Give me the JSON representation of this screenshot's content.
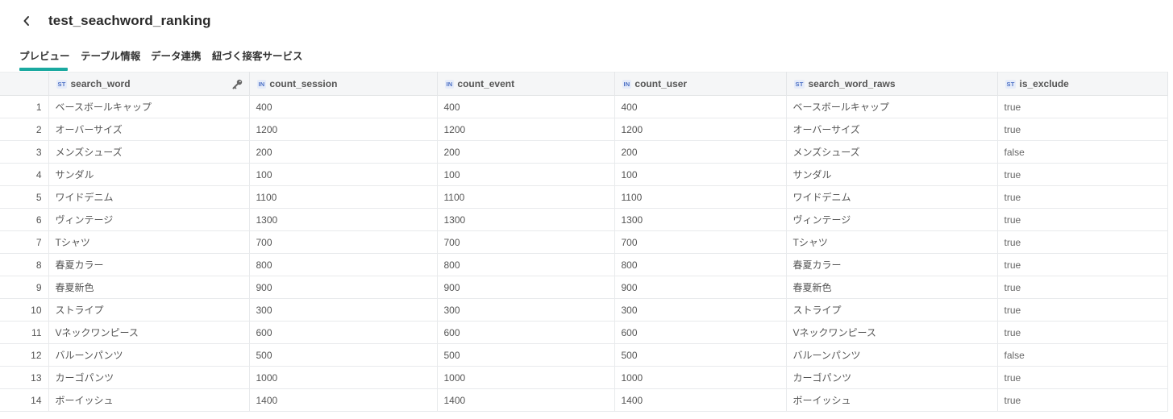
{
  "header": {
    "title": "test_seachword_ranking"
  },
  "tabs": [
    {
      "label": "プレビュー"
    },
    {
      "label": "テーブル情報"
    },
    {
      "label": "データ連携"
    },
    {
      "label": "紐づく接客サービス"
    }
  ],
  "columns": [
    {
      "type": "ST",
      "name": "search_word"
    },
    {
      "type": "IN",
      "name": "count_session"
    },
    {
      "type": "IN",
      "name": "count_event"
    },
    {
      "type": "IN",
      "name": "count_user"
    },
    {
      "type": "ST",
      "name": "search_word_raws"
    },
    {
      "type": "ST",
      "name": "is_exclude"
    }
  ],
  "rows": [
    {
      "num": "1",
      "cells": [
        "ベースボールキャップ",
        "400",
        "400",
        "400",
        "ベースボールキャップ",
        "true"
      ]
    },
    {
      "num": "2",
      "cells": [
        "オーバーサイズ",
        "1200",
        "1200",
        "1200",
        "オーバーサイズ",
        "true"
      ]
    },
    {
      "num": "3",
      "cells": [
        "メンズシューズ",
        "200",
        "200",
        "200",
        "メンズシューズ",
        "false"
      ]
    },
    {
      "num": "4",
      "cells": [
        "サンダル",
        "100",
        "100",
        "100",
        "サンダル",
        "true"
      ]
    },
    {
      "num": "5",
      "cells": [
        "ワイドデニム",
        "1100",
        "1100",
        "1100",
        "ワイドデニム",
        "true"
      ]
    },
    {
      "num": "6",
      "cells": [
        "ヴィンテージ",
        "1300",
        "1300",
        "1300",
        "ヴィンテージ",
        "true"
      ]
    },
    {
      "num": "7",
      "cells": [
        "Tシャツ",
        "700",
        "700",
        "700",
        "Tシャツ",
        "true"
      ]
    },
    {
      "num": "8",
      "cells": [
        "春夏カラー",
        "800",
        "800",
        "800",
        "春夏カラー",
        "true"
      ]
    },
    {
      "num": "9",
      "cells": [
        "春夏新色",
        "900",
        "900",
        "900",
        "春夏新色",
        "true"
      ]
    },
    {
      "num": "10",
      "cells": [
        "ストライプ",
        "300",
        "300",
        "300",
        "ストライプ",
        "true"
      ]
    },
    {
      "num": "11",
      "cells": [
        "Vネックワンピース",
        "600",
        "600",
        "600",
        "Vネックワンピース",
        "true"
      ]
    },
    {
      "num": "12",
      "cells": [
        "バルーンパンツ",
        "500",
        "500",
        "500",
        "バルーンパンツ",
        "false"
      ]
    },
    {
      "num": "13",
      "cells": [
        "カーゴパンツ",
        "1000",
        "1000",
        "1000",
        "カーゴパンツ",
        "true"
      ]
    },
    {
      "num": "14",
      "cells": [
        "ボーイッシュ",
        "1400",
        "1400",
        "1400",
        "ボーイッシュ",
        "true"
      ]
    }
  ],
  "colors": {
    "accent": "#1aa9a0",
    "type_badge": "#4a6fc4"
  },
  "icons": {
    "back": "chevron-left-icon",
    "primary_key": "key-icon"
  }
}
